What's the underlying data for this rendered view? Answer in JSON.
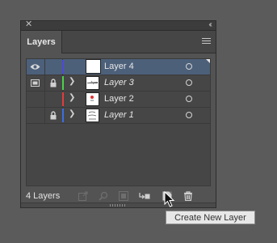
{
  "panel": {
    "close_glyph": "✕",
    "collapse_glyph": "‹‹",
    "tab_label": "Layers",
    "menu_icon": "hamburger-menu-icon"
  },
  "layers": [
    {
      "name": "Layer 4",
      "italic": false,
      "color": "#4f49d6",
      "visible": true,
      "locked": false,
      "template": false,
      "selected": true,
      "expandable": false
    },
    {
      "name": "Layer 3",
      "italic": true,
      "color": "#4cd14c",
      "visible": false,
      "locked": true,
      "template": true,
      "selected": false,
      "expandable": true
    },
    {
      "name": "Layer 2",
      "italic": false,
      "color": "#e23c3c",
      "visible": false,
      "locked": false,
      "template": false,
      "selected": false,
      "expandable": true
    },
    {
      "name": "Layer 1",
      "italic": true,
      "color": "#3d6fe0",
      "visible": false,
      "locked": true,
      "template": false,
      "selected": false,
      "expandable": true
    }
  ],
  "status": {
    "count_label": "4 Layers"
  },
  "toolbar": {
    "icons": [
      "collect-for-export-icon",
      "locate-object-icon",
      "make-clipping-mask-icon",
      "create-new-sublayer-icon",
      "create-new-layer-icon",
      "delete-layer-icon"
    ]
  },
  "tooltip": {
    "text": "Create New Layer"
  },
  "colors": {
    "background": "#5b5b5b",
    "panel": "#535353",
    "selection": "#4c607a"
  }
}
